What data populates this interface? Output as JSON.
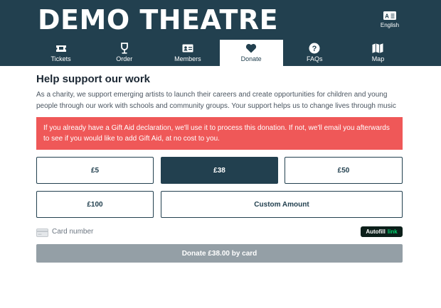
{
  "header": {
    "logo": "DEMO THEATRE",
    "language": "English",
    "language_icon": "translate-icon"
  },
  "nav": {
    "items": [
      {
        "label": "Tickets",
        "icon": "ticket-icon"
      },
      {
        "label": "Order",
        "icon": "glass-icon"
      },
      {
        "label": "Members",
        "icon": "member-card-icon"
      },
      {
        "label": "Donate",
        "icon": "heart-icon",
        "active": true
      },
      {
        "label": "FAQs",
        "icon": "question-icon"
      },
      {
        "label": "Map",
        "icon": "map-icon"
      }
    ]
  },
  "main": {
    "title": "Help support our work",
    "intro": "As a charity, we support emerging artists to launch their careers and create opportunities for children and young people through our work with schools and community groups. Your support helps us to change lives through music",
    "alert": "If you already have a Gift Aid declaration, we'll use it to process this donation. If not, we'll email you afterwards to see if you would like to add Gift Aid, at no cost to you."
  },
  "amounts": {
    "a1": "£5",
    "a2": "£38",
    "a3": "£50",
    "a4": "£100",
    "custom": "Custom Amount",
    "selected": "£38"
  },
  "payment": {
    "card_label": "Card number",
    "autofill_text": "Autofill",
    "autofill_link": "link",
    "submit": "Donate £38.00 by card"
  },
  "colors": {
    "header_bg": "#22404f",
    "alert_bg": "#ef5858",
    "button_disabled": "#949fa6",
    "link_green": "#00d66f"
  }
}
